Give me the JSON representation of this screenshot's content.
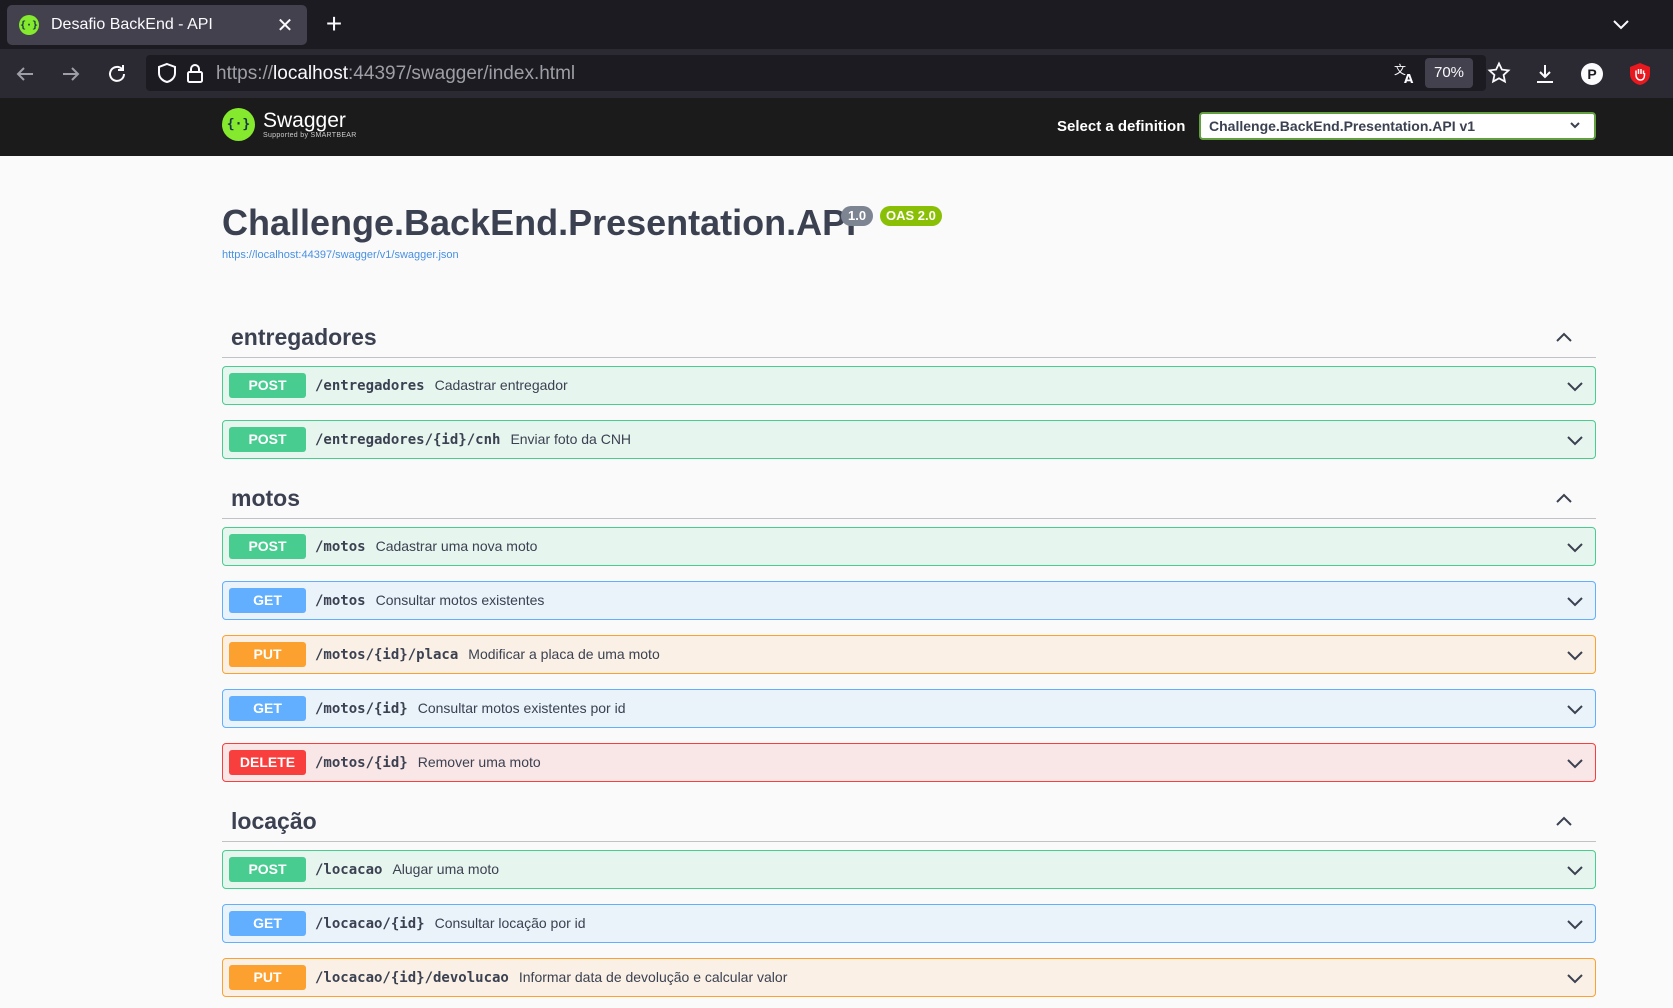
{
  "browser": {
    "tab_title": "Desafio BackEnd - API",
    "url_prefix": "https://",
    "url_host": "localhost",
    "url_rest": ":44397/swagger/index.html",
    "zoom": "70%",
    "profile_letter": "P"
  },
  "swagger": {
    "logo_text": "Swagger",
    "logo_sub": "Supported by SMARTBEAR",
    "definition_label": "Select a definition",
    "definition_value": "Challenge.BackEnd.Presentation.API v1"
  },
  "info": {
    "title": "Challenge.BackEnd.Presentation.API",
    "version": "1.0",
    "oas": "OAS 2.0",
    "url": "https://localhost:44397/swagger/v1/swagger.json"
  },
  "sections": [
    {
      "name": "entregadores",
      "ops": [
        {
          "method": "POST",
          "path": "/entregadores",
          "summary": "Cadastrar entregador"
        },
        {
          "method": "POST",
          "path": "/entregadores/{id}/cnh",
          "summary": "Enviar foto da CNH"
        }
      ]
    },
    {
      "name": "motos",
      "ops": [
        {
          "method": "POST",
          "path": "/motos",
          "summary": "Cadastrar uma nova moto"
        },
        {
          "method": "GET",
          "path": "/motos",
          "summary": "Consultar motos existentes"
        },
        {
          "method": "PUT",
          "path": "/motos/{id}/placa",
          "summary": "Modificar a placa de uma moto"
        },
        {
          "method": "GET",
          "path": "/motos/{id}",
          "summary": "Consultar motos existentes por id"
        },
        {
          "method": "DELETE",
          "path": "/motos/{id}",
          "summary": "Remover uma moto"
        }
      ]
    },
    {
      "name": "locação",
      "ops": [
        {
          "method": "POST",
          "path": "/locacao",
          "summary": "Alugar uma moto"
        },
        {
          "method": "GET",
          "path": "/locacao/{id}",
          "summary": "Consultar locação por id"
        },
        {
          "method": "PUT",
          "path": "/locacao/{id}/devolucao",
          "summary": "Informar data de devolução e calcular valor"
        }
      ]
    }
  ]
}
